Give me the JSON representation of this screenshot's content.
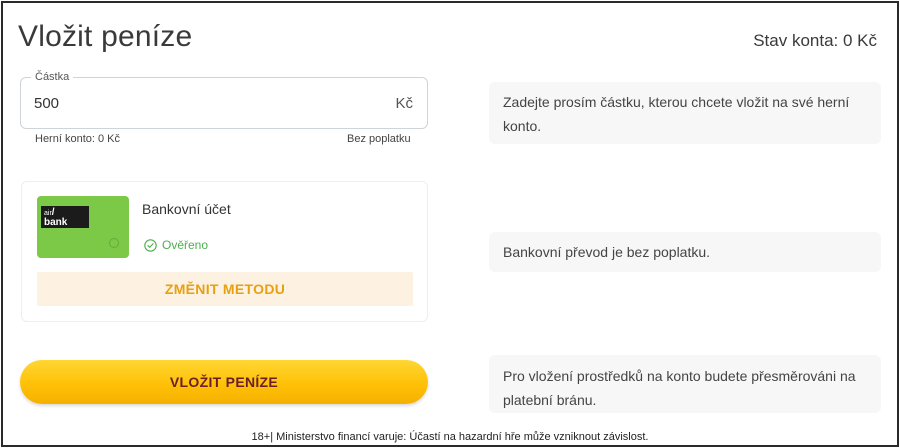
{
  "header": {
    "title": "Vložit peníze",
    "balance": "Stav konta: 0 Kč"
  },
  "amount": {
    "legend": "Částka",
    "value": "500",
    "currency": "Kč",
    "hint_left": "Herní konto: 0 Kč",
    "hint_right": "Bez poplatku"
  },
  "method": {
    "logo_top": "air",
    "logo_bottom": "bank",
    "name": "Bankovní účet",
    "status": "Ověřeno",
    "change_label": "ZMĚNIT METODU"
  },
  "info": {
    "amount_hint": "Zadejte prosím částku, kterou chcete vložit na své herní konto.",
    "method_hint": "Bankovní převod je bez poplatku.",
    "deposit_hint": "Pro vložení prostředků na konto budete přesměrováni na platební bránu."
  },
  "deposit": {
    "button_label": "VLOŽIT PENÍZE"
  },
  "footer": {
    "warning": "18+| Ministerstvo financí varuje: Účastí na hazardní hře může vzniknout závislost."
  },
  "colors": {
    "accent_yellow": "#ffc107",
    "change_text": "#e8a013",
    "verified_green": "#4caf50",
    "card_green": "#7cc847"
  },
  "icons": {
    "verified": "check-circle-icon"
  }
}
